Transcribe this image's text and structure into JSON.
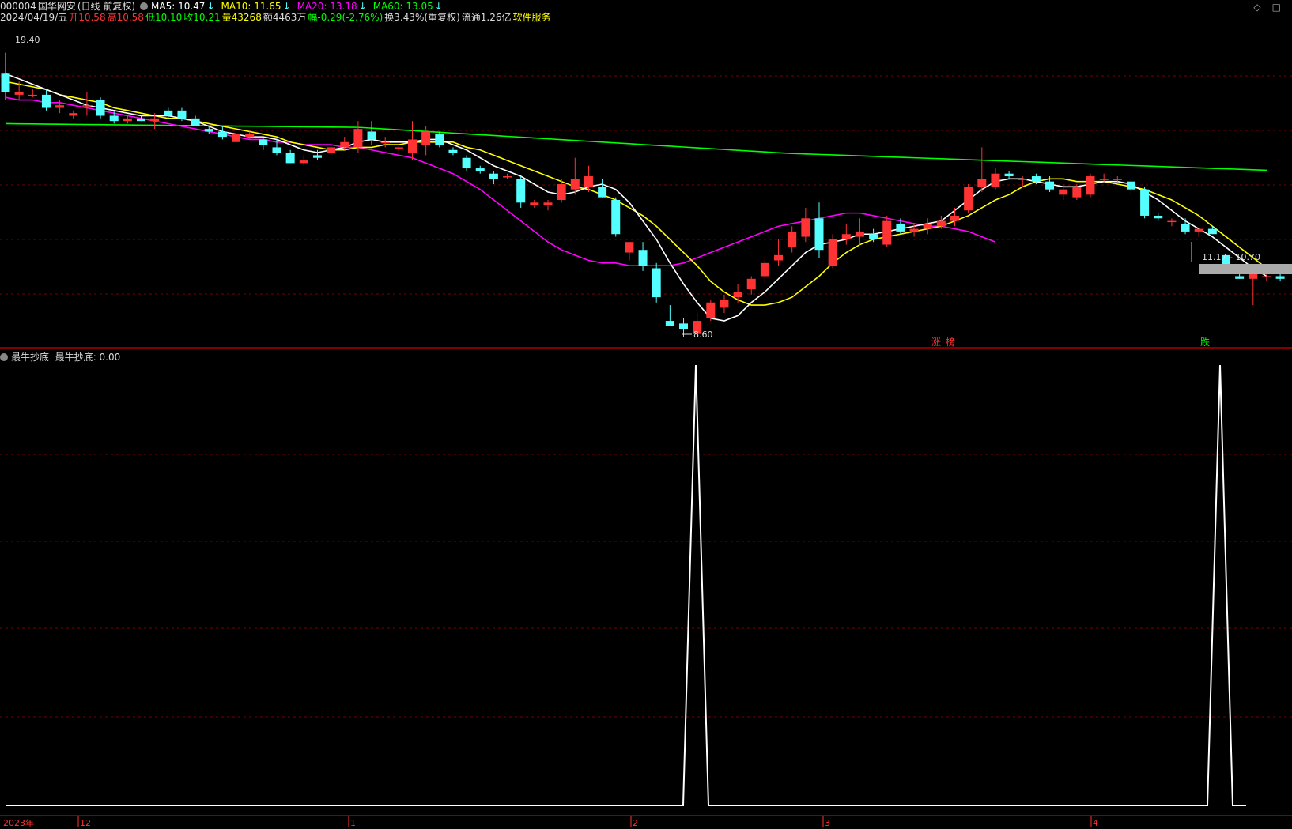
{
  "quote": {
    "code": "000004",
    "name": "国华网安",
    "period": "(日线 前复权)",
    "ma5": "MA5: 10.47",
    "ma10": "MA10: 11.65",
    "ma20": "MA20: 13.18",
    "ma60": "MA60: 13.05",
    "arrow": "↓",
    "date": "2024/04/19/五",
    "open": "开10.58",
    "high": "高10.58",
    "low": "低10.10",
    "close": "收10.21",
    "volume": "量43268",
    "amount": "额4463万",
    "change": "幅-0.29(-2.76%)",
    "turnover": "换3.43%(重复权)",
    "float": "流通1.26亿",
    "service": "软件服务"
  },
  "top_right": {
    "diamond": "◇",
    "square": "□"
  },
  "labels": {
    "high_mark": "19.40",
    "low_mark": "8.60",
    "range": "11.17 - 10.70",
    "up_tag_1": "涨",
    "up_tag_2": "榜",
    "down_tag": "跌"
  },
  "indicator": {
    "title": "最牛抄底",
    "value_label": "最牛抄底: 0.00"
  },
  "axis": {
    "year": "2023年",
    "months": [
      "12",
      "1",
      "2",
      "3",
      "4"
    ]
  },
  "colors": {
    "up": "#ff3333",
    "down": "#54ffff",
    "ma5": "#ffffff",
    "ma10": "#ffff00",
    "ma20": "#ff00ff",
    "ma60": "#00ff00",
    "grid": "#7a0000"
  },
  "chart_data": {
    "type": "candlestick",
    "price_range": [
      8.3,
      19.9
    ],
    "candles": [
      {
        "o": 18.6,
        "h": 19.4,
        "l": 17.6,
        "c": 17.9
      },
      {
        "o": 17.8,
        "h": 18.3,
        "l": 17.6,
        "c": 17.9
      },
      {
        "o": 17.8,
        "h": 18.0,
        "l": 17.7,
        "c": 17.8
      },
      {
        "o": 17.8,
        "h": 18.0,
        "l": 17.2,
        "c": 17.3
      },
      {
        "o": 17.3,
        "h": 17.6,
        "l": 17.1,
        "c": 17.4
      },
      {
        "o": 17.0,
        "h": 17.2,
        "l": 16.9,
        "c": 17.1
      },
      {
        "o": 17.4,
        "h": 17.9,
        "l": 17.0,
        "c": 17.4
      },
      {
        "o": 17.6,
        "h": 17.7,
        "l": 16.9,
        "c": 17.0
      },
      {
        "o": 17.0,
        "h": 17.2,
        "l": 16.7,
        "c": 16.8
      },
      {
        "o": 16.8,
        "h": 17.0,
        "l": 16.7,
        "c": 16.9
      },
      {
        "o": 16.9,
        "h": 17.0,
        "l": 16.8,
        "c": 16.8
      },
      {
        "o": 16.8,
        "h": 17.1,
        "l": 16.5,
        "c": 16.9
      },
      {
        "o": 17.2,
        "h": 17.3,
        "l": 16.9,
        "c": 17.0
      },
      {
        "o": 17.2,
        "h": 17.3,
        "l": 16.8,
        "c": 16.9
      },
      {
        "o": 16.9,
        "h": 17.0,
        "l": 16.6,
        "c": 16.6
      },
      {
        "o": 16.5,
        "h": 16.6,
        "l": 16.3,
        "c": 16.4
      },
      {
        "o": 16.4,
        "h": 16.6,
        "l": 16.1,
        "c": 16.2
      },
      {
        "o": 16.0,
        "h": 16.5,
        "l": 15.9,
        "c": 16.3
      },
      {
        "o": 16.2,
        "h": 16.4,
        "l": 16.1,
        "c": 16.3
      },
      {
        "o": 16.1,
        "h": 16.2,
        "l": 15.7,
        "c": 15.9
      },
      {
        "o": 15.8,
        "h": 16.1,
        "l": 15.5,
        "c": 15.6
      },
      {
        "o": 15.6,
        "h": 15.7,
        "l": 15.2,
        "c": 15.2
      },
      {
        "o": 15.2,
        "h": 15.5,
        "l": 15.1,
        "c": 15.3
      },
      {
        "o": 15.5,
        "h": 15.7,
        "l": 15.3,
        "c": 15.4
      },
      {
        "o": 15.6,
        "h": 15.9,
        "l": 15.5,
        "c": 15.8
      },
      {
        "o": 15.8,
        "h": 16.2,
        "l": 15.7,
        "c": 16.0
      },
      {
        "o": 15.8,
        "h": 16.8,
        "l": 15.6,
        "c": 16.5
      },
      {
        "o": 16.4,
        "h": 16.8,
        "l": 15.9,
        "c": 16.1
      },
      {
        "o": 16.0,
        "h": 16.2,
        "l": 15.8,
        "c": 16.0
      },
      {
        "o": 15.8,
        "h": 16.1,
        "l": 15.6,
        "c": 15.8
      },
      {
        "o": 15.6,
        "h": 16.8,
        "l": 15.3,
        "c": 16.1
      },
      {
        "o": 15.9,
        "h": 16.6,
        "l": 15.5,
        "c": 16.4
      },
      {
        "o": 16.3,
        "h": 16.4,
        "l": 15.8,
        "c": 15.9
      },
      {
        "o": 15.7,
        "h": 15.8,
        "l": 15.5,
        "c": 15.6
      },
      {
        "o": 15.4,
        "h": 15.5,
        "l": 14.9,
        "c": 15.0
      },
      {
        "o": 15.0,
        "h": 15.1,
        "l": 14.8,
        "c": 14.9
      },
      {
        "o": 14.8,
        "h": 14.9,
        "l": 14.4,
        "c": 14.6
      },
      {
        "o": 14.7,
        "h": 14.8,
        "l": 14.6,
        "c": 14.7
      },
      {
        "o": 14.6,
        "h": 14.7,
        "l": 13.5,
        "c": 13.7
      },
      {
        "o": 13.6,
        "h": 13.8,
        "l": 13.5,
        "c": 13.7
      },
      {
        "o": 13.6,
        "h": 13.8,
        "l": 13.4,
        "c": 13.7
      },
      {
        "o": 13.8,
        "h": 14.6,
        "l": 13.7,
        "c": 14.4
      },
      {
        "o": 14.2,
        "h": 15.4,
        "l": 14.0,
        "c": 14.6
      },
      {
        "o": 14.3,
        "h": 15.1,
        "l": 14.1,
        "c": 14.7
      },
      {
        "o": 14.3,
        "h": 14.6,
        "l": 13.9,
        "c": 13.9
      },
      {
        "o": 13.8,
        "h": 13.9,
        "l": 12.4,
        "c": 12.5
      },
      {
        "o": 11.8,
        "h": 12.2,
        "l": 11.5,
        "c": 12.2
      },
      {
        "o": 11.9,
        "h": 12.2,
        "l": 11.1,
        "c": 11.3
      },
      {
        "o": 11.2,
        "h": 11.4,
        "l": 9.9,
        "c": 10.1
      },
      {
        "o": 9.2,
        "h": 9.8,
        "l": 9.0,
        "c": 9.0
      },
      {
        "o": 9.1,
        "h": 9.3,
        "l": 8.6,
        "c": 8.9
      },
      {
        "o": 8.7,
        "h": 9.5,
        "l": 8.6,
        "c": 9.2
      },
      {
        "o": 9.3,
        "h": 10.0,
        "l": 9.2,
        "c": 9.9
      },
      {
        "o": 9.7,
        "h": 10.2,
        "l": 9.5,
        "c": 10.0
      },
      {
        "o": 10.1,
        "h": 10.6,
        "l": 9.9,
        "c": 10.3
      },
      {
        "o": 10.4,
        "h": 10.9,
        "l": 10.2,
        "c": 10.8
      },
      {
        "o": 10.9,
        "h": 11.6,
        "l": 10.6,
        "c": 11.4
      },
      {
        "o": 11.5,
        "h": 12.3,
        "l": 11.3,
        "c": 11.7
      },
      {
        "o": 12.0,
        "h": 12.8,
        "l": 11.8,
        "c": 12.6
      },
      {
        "o": 12.4,
        "h": 13.5,
        "l": 12.2,
        "c": 13.1
      },
      {
        "o": 13.1,
        "h": 13.7,
        "l": 11.6,
        "c": 11.9
      },
      {
        "o": 11.3,
        "h": 12.5,
        "l": 11.2,
        "c": 12.3
      },
      {
        "o": 12.3,
        "h": 12.9,
        "l": 12.1,
        "c": 12.5
      },
      {
        "o": 12.4,
        "h": 13.1,
        "l": 12.1,
        "c": 12.6
      },
      {
        "o": 12.5,
        "h": 12.7,
        "l": 12.2,
        "c": 12.3
      },
      {
        "o": 12.1,
        "h": 13.2,
        "l": 12.0,
        "c": 13.0
      },
      {
        "o": 12.9,
        "h": 13.1,
        "l": 12.5,
        "c": 12.6
      },
      {
        "o": 12.6,
        "h": 12.9,
        "l": 12.4,
        "c": 12.7
      },
      {
        "o": 12.7,
        "h": 13.1,
        "l": 12.5,
        "c": 12.9
      },
      {
        "o": 12.8,
        "h": 13.2,
        "l": 12.7,
        "c": 13.0
      },
      {
        "o": 13.0,
        "h": 13.5,
        "l": 12.8,
        "c": 13.2
      },
      {
        "o": 13.4,
        "h": 14.4,
        "l": 13.3,
        "c": 14.3
      },
      {
        "o": 14.3,
        "h": 15.8,
        "l": 14.1,
        "c": 14.6
      },
      {
        "o": 14.3,
        "h": 15.0,
        "l": 14.2,
        "c": 14.8
      },
      {
        "o": 14.8,
        "h": 14.9,
        "l": 14.6,
        "c": 14.7
      },
      {
        "o": 14.6,
        "h": 14.7,
        "l": 14.3,
        "c": 14.6
      },
      {
        "o": 14.7,
        "h": 14.8,
        "l": 14.4,
        "c": 14.5
      },
      {
        "o": 14.5,
        "h": 14.7,
        "l": 14.1,
        "c": 14.2
      },
      {
        "o": 14.0,
        "h": 14.4,
        "l": 13.8,
        "c": 14.2
      },
      {
        "o": 13.9,
        "h": 14.4,
        "l": 13.8,
        "c": 14.3
      },
      {
        "o": 14.0,
        "h": 14.8,
        "l": 13.9,
        "c": 14.7
      },
      {
        "o": 14.6,
        "h": 14.8,
        "l": 14.5,
        "c": 14.6
      },
      {
        "o": 14.6,
        "h": 14.7,
        "l": 14.5,
        "c": 14.6
      },
      {
        "o": 14.5,
        "h": 14.6,
        "l": 14.0,
        "c": 14.2
      },
      {
        "o": 14.2,
        "h": 14.3,
        "l": 13.1,
        "c": 13.2
      },
      {
        "o": 13.2,
        "h": 13.3,
        "l": 13.0,
        "c": 13.1
      },
      {
        "o": 13.0,
        "h": 13.1,
        "l": 12.8,
        "c": 13.0
      },
      {
        "o": 12.9,
        "h": 13.1,
        "l": 12.5,
        "c": 12.6
      },
      {
        "o": 12.6,
        "h": 12.7,
        "l": 12.4,
        "c": 12.7
      },
      {
        "o": 12.7,
        "h": 12.8,
        "l": 12.5,
        "c": 12.5
      },
      {
        "o": 11.7,
        "h": 11.9,
        "l": 10.9,
        "c": 11.0
      },
      {
        "o": 10.9,
        "h": 11.0,
        "l": 10.8,
        "c": 10.8
      },
      {
        "o": 10.8,
        "h": 11.3,
        "l": 9.8,
        "c": 11.2
      },
      {
        "o": 10.9,
        "h": 11.2,
        "l": 10.7,
        "c": 10.9
      },
      {
        "o": 10.9,
        "h": 11.0,
        "l": 10.7,
        "c": 10.8
      }
    ],
    "ma5": [
      18.6,
      18.4,
      18.2,
      18.0,
      17.8,
      17.6,
      17.4,
      17.3,
      17.2,
      17.1,
      17.0,
      17.0,
      17.0,
      16.9,
      16.8,
      16.6,
      16.4,
      16.3,
      16.2,
      16.2,
      16.1,
      15.9,
      15.7,
      15.6,
      15.7,
      15.8,
      16.0,
      16.1,
      16.0,
      16.0,
      16.0,
      16.1,
      16.1,
      15.9,
      15.7,
      15.4,
      15.1,
      14.9,
      14.7,
      14.4,
      14.1,
      14.0,
      14.1,
      14.3,
      14.4,
      14.2,
      13.7,
      13.0,
      12.3,
      11.4,
      10.6,
      9.9,
      9.3,
      9.2,
      9.4,
      9.9,
      10.3,
      10.8,
      11.3,
      11.8,
      12.1,
      12.2,
      12.3,
      12.5,
      12.5,
      12.6,
      12.7,
      12.8,
      12.9,
      13.0,
      13.4,
      13.8,
      14.2,
      14.5,
      14.6,
      14.6,
      14.5,
      14.4,
      14.3,
      14.3,
      14.4,
      14.5,
      14.5,
      14.4,
      14.1,
      13.8,
      13.4,
      13.0,
      12.7,
      12.4,
      12.0,
      11.6,
      11.2,
      10.9
    ],
    "ma10": [
      18.3,
      18.2,
      18.1,
      18.0,
      17.8,
      17.7,
      17.6,
      17.5,
      17.3,
      17.2,
      17.1,
      17.0,
      16.9,
      16.9,
      16.8,
      16.7,
      16.6,
      16.5,
      16.4,
      16.3,
      16.2,
      16.0,
      15.9,
      15.8,
      15.7,
      15.7,
      15.8,
      15.8,
      15.9,
      15.9,
      16.0,
      16.0,
      16.0,
      16.0,
      15.8,
      15.7,
      15.5,
      15.3,
      15.1,
      14.9,
      14.7,
      14.5,
      14.3,
      14.2,
      14.0,
      13.8,
      13.5,
      13.2,
      12.8,
      12.3,
      11.8,
      11.3,
      10.7,
      10.3,
      10.0,
      9.8,
      9.8,
      9.9,
      10.1,
      10.5,
      10.9,
      11.4,
      11.8,
      12.1,
      12.3,
      12.4,
      12.5,
      12.6,
      12.7,
      12.8,
      13.0,
      13.2,
      13.5,
      13.8,
      14.0,
      14.3,
      14.5,
      14.6,
      14.6,
      14.5,
      14.5,
      14.5,
      14.4,
      14.3,
      14.2,
      14.0,
      13.8,
      13.5,
      13.2,
      12.8,
      12.4,
      12.0,
      11.6,
      11.2
    ],
    "ma20": [
      17.7,
      17.6,
      17.6,
      17.5,
      17.5,
      17.4,
      17.3,
      17.2,
      17.1,
      17.0,
      16.9,
      16.8,
      16.7,
      16.6,
      16.5,
      16.4,
      16.3,
      16.2,
      16.1,
      16.1,
      16.0,
      16.0,
      15.9,
      15.9,
      15.9,
      15.8,
      15.8,
      15.7,
      15.6,
      15.5,
      15.4,
      15.2,
      15.0,
      14.8,
      14.5,
      14.2,
      13.8,
      13.4,
      13.0,
      12.6,
      12.2,
      11.9,
      11.7,
      11.5,
      11.4,
      11.4,
      11.3,
      11.3,
      11.3,
      11.3,
      11.4,
      11.6,
      11.8,
      12.0,
      12.2,
      12.4,
      12.6,
      12.8,
      12.9,
      13.0,
      13.1,
      13.2,
      13.3,
      13.3,
      13.2,
      13.1,
      13.0,
      12.9,
      12.8,
      12.8,
      12.7,
      12.6,
      12.4,
      12.2
    ]
  },
  "indicator_data": {
    "spikes_at": [
      51,
      92
    ],
    "peak": 1.0
  }
}
